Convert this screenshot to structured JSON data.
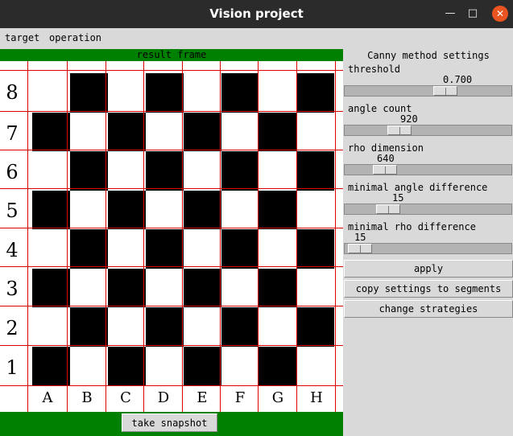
{
  "window": {
    "title": "Vision project",
    "min_icon": "minimize-icon",
    "max_icon": "maximize-icon",
    "close_icon": "close-icon"
  },
  "menu": {
    "items": [
      "target",
      "operation"
    ]
  },
  "left": {
    "frame_label": "result frame",
    "snapshot_label": "take snapshot",
    "ranks": [
      "8",
      "7",
      "6",
      "5",
      "4",
      "3",
      "2",
      "1"
    ],
    "files": [
      "A",
      "B",
      "C",
      "D",
      "E",
      "F",
      "G",
      "H"
    ],
    "green": "#008000",
    "grid_color": "#e00000"
  },
  "settings": {
    "title": "Canny method settings",
    "sliders": [
      {
        "label": "threshold",
        "value": "0.700",
        "level": 0.62
      },
      {
        "label": "angle count",
        "value": "920",
        "level": 0.3
      },
      {
        "label": "rho dimension",
        "value": "640",
        "level": 0.2
      },
      {
        "label": "minimal angle difference",
        "value": "15",
        "level": 0.22
      },
      {
        "label": "minimal rho difference",
        "value": "15",
        "level": 0.02
      }
    ],
    "buttons": {
      "apply": "apply",
      "copy": "copy settings to segments",
      "change": "change strategies"
    }
  }
}
